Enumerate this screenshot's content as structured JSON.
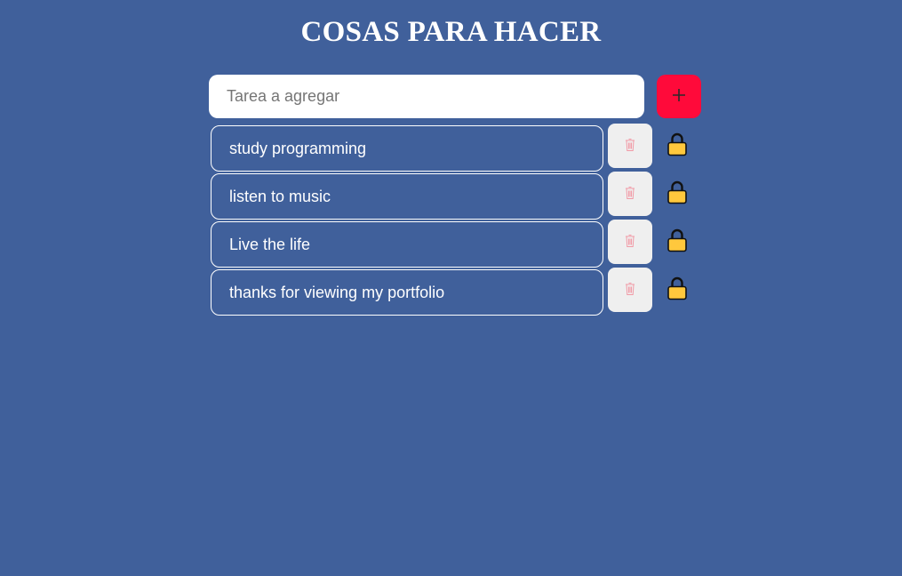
{
  "header": {
    "title": "COSAS PARA HACER"
  },
  "new_task": {
    "placeholder": "Tarea a agregar",
    "value": "",
    "add_icon": "plus-icon"
  },
  "tasks": [
    {
      "text": "study programming",
      "delete_icon": "trash-icon",
      "lock_icon": "lock-icon"
    },
    {
      "text": "listen to music",
      "delete_icon": "trash-icon",
      "lock_icon": "lock-icon"
    },
    {
      "text": "Live the life",
      "delete_icon": "trash-icon",
      "lock_icon": "lock-icon"
    },
    {
      "text": "thanks for viewing my portfolio",
      "delete_icon": "trash-icon",
      "lock_icon": "lock-icon"
    }
  ],
  "colors": {
    "background": "#40609b",
    "add_button": "#ff0a3a",
    "delete_button": "#efefef",
    "trash_icon": "#f19aa6",
    "lock_body": "#ffc83d"
  }
}
